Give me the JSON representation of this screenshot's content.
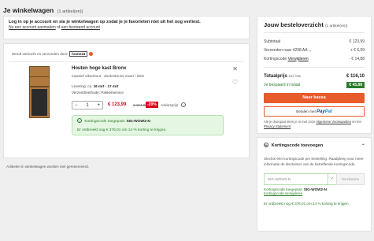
{
  "header": {
    "title": "Je winkelwagen",
    "count": "(1 artikel(en))"
  },
  "login": {
    "line1": "Log in op je account en sla je winkelwagen op zodat je je favorieten niet uit het oog verliest.",
    "link1": "Nu een account aanmaken",
    "mid": "of",
    "link2": "een bestaand account"
  },
  "seller": {
    "label": "Wordt verkocht en verzonden door:",
    "brand": "home24"
  },
  "product": {
    "name": "Houten hoge kast Bronx",
    "desc": "massief eikenhout - donkerbruin/ zwart / links",
    "delivery_label": "Levering: ca.",
    "delivery_value": "16 mrt - 17 mrt",
    "shipping": "Verzendmethode: Pakketservice",
    "qty": "1",
    "qty_minus": "−",
    "qty_plus": "+",
    "price": "€ 123,99",
    "old_price": "€ 154,99",
    "discount": "-20%",
    "advies": "Adviesprijs",
    "info": "i"
  },
  "coupon_notice": {
    "applied_label": "Kortingscode toegepast:",
    "code": "SIG-WOW2-N",
    "saving": "Er ontbreekt nog € 376,01 om 14 % korting te krijgen."
  },
  "note": "Artikelen in winkelwagen worden niet gereserveerd.",
  "summary": {
    "title": "Jouw besteloverzicht",
    "count": "(1 artikel(en))",
    "subtotal_label": "Subtotaal",
    "subtotal_value": "€ 123,99",
    "shipping_label": "Verzenden naar 4298 AA",
    "shipping_value": "+ € 6,99",
    "coupon_label": "Kortingscode",
    "coupon_remove": "Verwijderen",
    "coupon_value": "- € 14,88",
    "total_label": "Totaalprijs",
    "total_note": "incl. btw",
    "total_value": "€ 116,10",
    "saved_label": "Je bespaard in totaal",
    "saved_value": "€ 45,88",
    "checkout_button": "Naar kassa",
    "paypal_prefix": "Betalen met",
    "paypal_brand_a": "Pay",
    "paypal_brand_b": "Pal",
    "legal_a": "Als je doorgaat stem je in met onze",
    "legal_link1": "Algemene Voorwaarden",
    "legal_b": "en het",
    "legal_link2": "Privacy Statement"
  },
  "coupon_panel": {
    "title": "Kortingscode toevoegen",
    "toggle": "−",
    "text": "Slechts één kortingscode per bestelling. Raadpleeg voor meer informatie de disclaimer van de betreffende kortingscode.",
    "input_value": "SIG-WOW2-N",
    "verify_button": "Verzilveren",
    "applied_label": "Kortingscode toegepast:",
    "applied_code": "SIG-WOW2-N",
    "remove_link": "Kortingscode verwijderen",
    "saving": "Er ontbreekt nog € 376,01 om 14 % korting te krijgen."
  },
  "colors": {
    "accent": "#e85b2a",
    "price_red": "#e1001a",
    "success_green": "#2a7d2a"
  }
}
